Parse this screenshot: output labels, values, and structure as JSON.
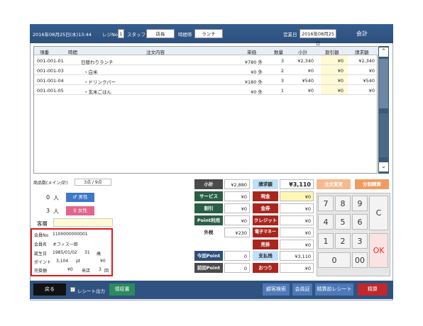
{
  "header": {
    "date": "2016年08月25日(木)13:44",
    "register_label": "レジNo",
    "register_no": "1",
    "staff_label": "スタッフ",
    "staff_name": "店長",
    "timeslot_label": "時間帯",
    "timeslot_value": "ランチ",
    "business_day_label": "営業日",
    "business_day": "2016年08月25日",
    "mode_title": "会計"
  },
  "order_table": {
    "columns": [
      "項番",
      "時間",
      "注文内容",
      "単価",
      "数量",
      "小計",
      "割引額",
      "請求額"
    ],
    "rows": [
      [
        "001-001-01",
        "",
        "日替わりランチ",
        "¥780 外",
        "3",
        "¥2,340",
        "¥0",
        "¥2,340"
      ],
      [
        "001-001-03",
        "",
        "・白米",
        "¥0 外",
        "2",
        "¥0",
        "¥0",
        "¥0"
      ],
      [
        "001-001-04",
        "",
        "・ドリンクバー",
        "¥180 外",
        "3",
        "¥540",
        "¥0",
        "¥540"
      ],
      [
        "001-001-05",
        "",
        "・玄米ごはん",
        "¥0 外",
        "1",
        "¥0",
        "¥0",
        "¥0"
      ]
    ]
  },
  "item_count": {
    "label": "商品数(メイン/計)",
    "value": "3点 / 9点"
  },
  "guests": {
    "male_count": "0",
    "male_unit": "人",
    "male_label": "男性",
    "female_count": "3",
    "female_unit": "人",
    "female_label": "女性",
    "segment_label": "客層"
  },
  "member": {
    "no_label": "会員No",
    "no_value": "1100000000001",
    "name_label": "会員名",
    "name_value": "オフィス一郎",
    "birthday_label": "誕生日",
    "birthday_value": "1985/01/02",
    "age_value": "31",
    "age_unit": "歳",
    "points_label": "ポイント",
    "points_value": "3,104",
    "points_unit": "pt",
    "points_yen": "¥0",
    "sales_label": "売掛額",
    "sales_value": "¥0",
    "visit_label": "来店",
    "visit_value": "3",
    "visit_unit": "回"
  },
  "totals": {
    "subtotal_label": "小計",
    "subtotal_value": "¥2,880",
    "service_label": "サービス",
    "service_value": "¥0",
    "discount_label": "割引",
    "discount_value": "¥0",
    "point_use_label": "Point利用",
    "point_use_value": "¥0",
    "tax_label": "外税",
    "tax_value": "¥230",
    "today_point_label": "今回Point",
    "today_point_value": "0",
    "prev_point_label": "前回Point",
    "prev_point_value": "0"
  },
  "payment": {
    "billing_label": "請求額",
    "billing_value": "¥3,110",
    "cash_label": "現金",
    "cash_value": "¥0",
    "voucher_label": "金券",
    "voucher_value": "¥0",
    "credit_label": "クレジット",
    "credit_value": "¥0",
    "emoney_label": "電子マネー",
    "emoney_value": "¥0",
    "ar_label": "売掛",
    "ar_value": "¥0",
    "paid_label": "支払残",
    "paid_value": "¥3,110",
    "change_label": "おつり",
    "change_value": "¥0"
  },
  "actions": {
    "order_change": "注文変更",
    "split_bill": "分割精算"
  },
  "keypad": {
    "keys": [
      "7",
      "8",
      "9",
      "4",
      "5",
      "6",
      "1",
      "2",
      "3",
      "0",
      "00"
    ],
    "clear": "C",
    "ok": "OK"
  },
  "footer": {
    "back": "戻る",
    "receipt_checkbox": "レシート出力",
    "receipt_button": "領収書",
    "customer_search": "顧客検索",
    "member_card": "会員証",
    "pre_receipt": "精算前レシート",
    "settle": "精算"
  },
  "colors": {
    "header_bg": "#2f5280",
    "highlight": "#e0181b",
    "accent_orange": "#f29b5f",
    "ok_red": "#e03030"
  }
}
